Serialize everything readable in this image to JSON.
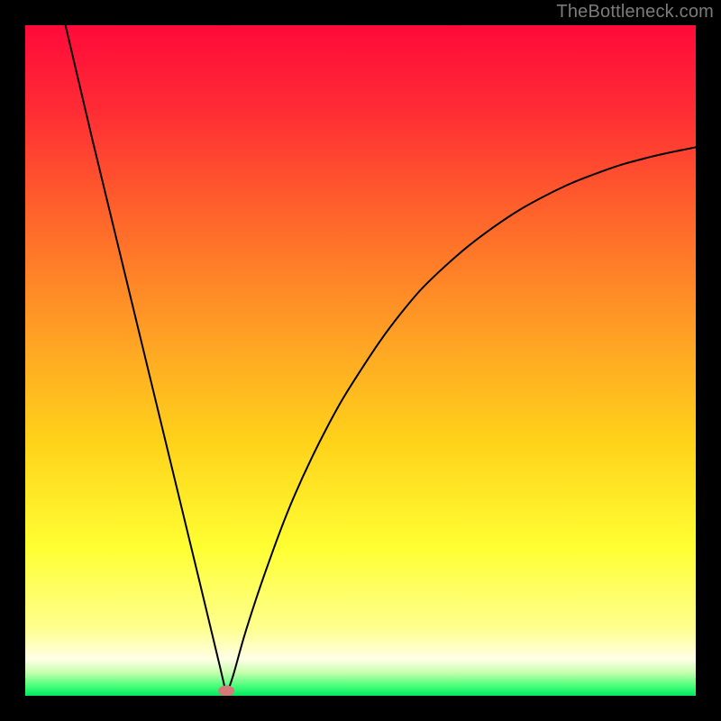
{
  "watermark": "TheBottleneck.com",
  "chart_data": {
    "type": "line",
    "title": "",
    "xlabel": "",
    "ylabel": "",
    "xlim": [
      0,
      1
    ],
    "ylim": [
      0,
      1
    ],
    "background_gradient": {
      "stops": [
        {
          "offset": 0.0,
          "color": "#ff0a3a"
        },
        {
          "offset": 0.12,
          "color": "#ff2a35"
        },
        {
          "offset": 0.3,
          "color": "#ff6a2a"
        },
        {
          "offset": 0.48,
          "color": "#ffa624"
        },
        {
          "offset": 0.62,
          "color": "#ffd21a"
        },
        {
          "offset": 0.78,
          "color": "#ffff33"
        },
        {
          "offset": 0.9,
          "color": "#ffff90"
        },
        {
          "offset": 0.945,
          "color": "#ffffe6"
        },
        {
          "offset": 0.965,
          "color": "#c8ffb0"
        },
        {
          "offset": 0.985,
          "color": "#4bff7a"
        },
        {
          "offset": 1.0,
          "color": "#00e860"
        }
      ]
    },
    "series": [
      {
        "name": "bottleneck-curve",
        "color": "#000000",
        "comment": "V-shaped curve: steep linear descent from top-left to a minimum near x≈0.30, then a concave-up rise approaching ~0.82 at x=1. y values are fraction from top (0=top, 1=bottom).",
        "x": [
          0.06,
          0.1,
          0.14,
          0.18,
          0.22,
          0.26,
          0.29,
          0.3,
          0.31,
          0.33,
          0.36,
          0.4,
          0.45,
          0.5,
          0.56,
          0.62,
          0.7,
          0.78,
          0.86,
          0.93,
          1.0
        ],
        "y": [
          0.0,
          0.17,
          0.335,
          0.5,
          0.665,
          0.83,
          0.955,
          0.998,
          0.97,
          0.9,
          0.81,
          0.705,
          0.6,
          0.515,
          0.43,
          0.365,
          0.3,
          0.252,
          0.218,
          0.197,
          0.182
        ],
        "minimum_marker": {
          "x": 0.3,
          "y": 0.998,
          "color": "#d47a7a"
        }
      }
    ]
  }
}
